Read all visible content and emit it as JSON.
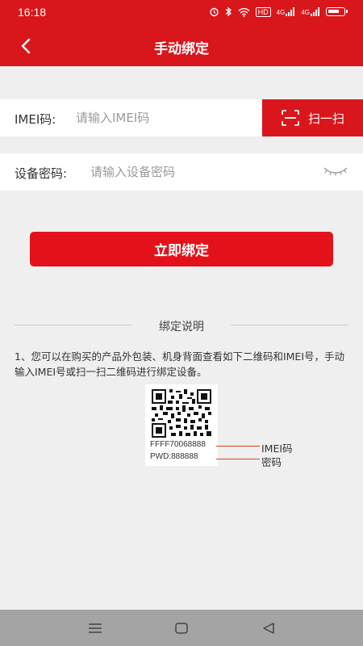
{
  "status_bar": {
    "time": "16:18",
    "hd_label": "HD",
    "signal_1": "4G",
    "signal_2": "4G"
  },
  "nav": {
    "title": "手动绑定",
    "back_icon": "chevron-left-icon"
  },
  "imei_field": {
    "label": "IMEI码:",
    "placeholder": "请输入IMEI码",
    "value": ""
  },
  "scan_button": {
    "label": "扫一扫",
    "icon": "scan-icon"
  },
  "password_field": {
    "label": "设备密码:",
    "placeholder": "请输入设备密码",
    "value": "",
    "toggle_icon": "eye-closed-icon"
  },
  "bind_button": {
    "label": "立即绑定"
  },
  "instructions": {
    "title": "绑定说明",
    "text": "1、您可以在购买的产品外包装、机身背面查看如下二维码和IMEI号，手动输入IMEI号或扫一扫二维码进行绑定设备。",
    "qr_imei": "FFFF70068888",
    "qr_password": "PWD:888888",
    "imei_label": "IMEI码",
    "password_label": "密码"
  },
  "colors": {
    "brand_red": "#d9161c",
    "button_red": "#e3121a",
    "background": "#efefef"
  },
  "system_nav": {
    "menu_icon": "menu-icon",
    "home_icon": "home-icon",
    "back_icon": "back-triangle-icon"
  }
}
